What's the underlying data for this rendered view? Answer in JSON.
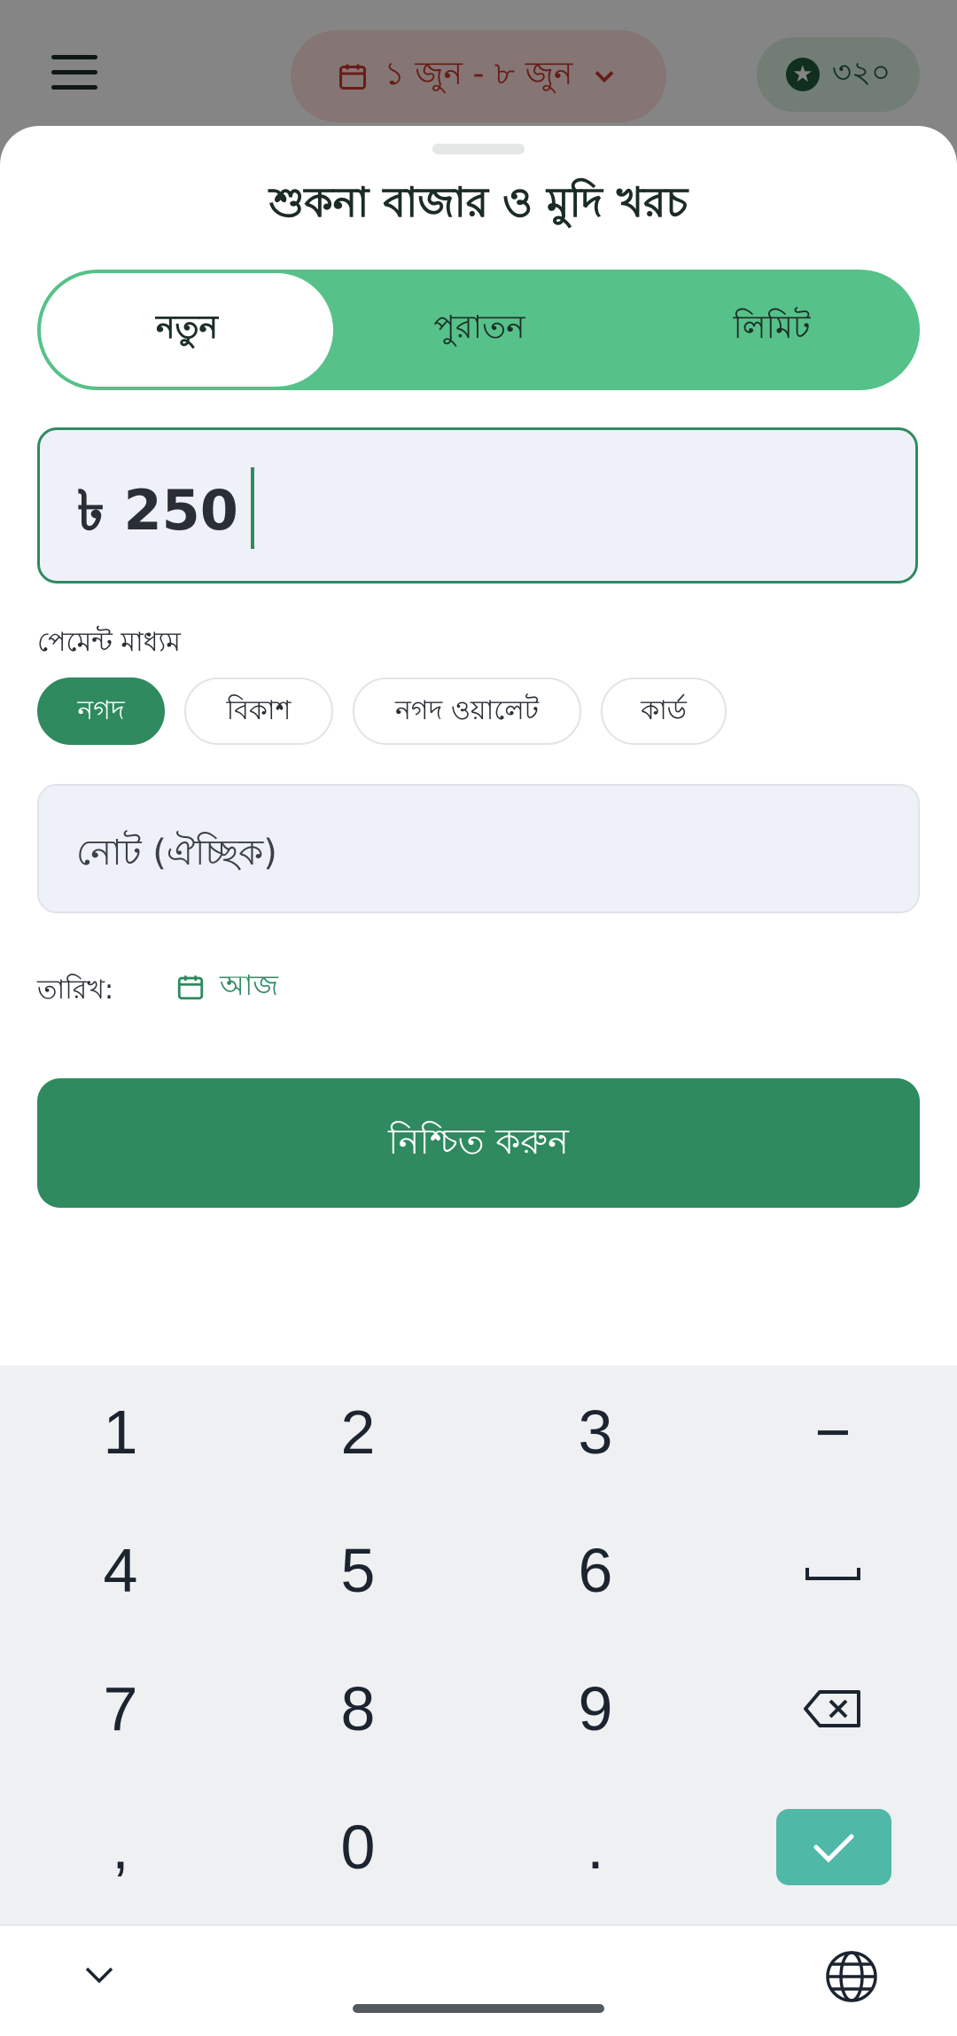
{
  "header": {
    "date_range": "১ জুন - ৮ জুন",
    "points": "৩২০"
  },
  "sheet": {
    "title": "শুকনা বাজার ও মুদি খরচ",
    "tabs": [
      {
        "label": "নতুন",
        "active": true
      },
      {
        "label": "পুরাতন",
        "active": false
      },
      {
        "label": "লিমিট",
        "active": false
      }
    ],
    "amount": {
      "value": "৳ 250"
    },
    "payment": {
      "label": "পেমেন্ট মাধ্যম",
      "options": [
        "নগদ",
        "বিকাশ",
        "নগদ ওয়ালেট",
        "কার্ড"
      ],
      "selected": "নগদ"
    },
    "note": {
      "placeholder": "নোট (ঐচ্ছিক)"
    },
    "date": {
      "label": "তারিখ:",
      "value": "আজ"
    },
    "confirm_label": "নিশ্চিত করুন"
  },
  "keyboard": {
    "rows": [
      [
        "1",
        "2",
        "3",
        "−"
      ],
      [
        "4",
        "5",
        "6",
        "space"
      ],
      [
        "7",
        "8",
        "9",
        "backspace"
      ],
      [
        ",",
        "0",
        ".",
        "enter"
      ]
    ],
    "labels": {
      "k1": "1",
      "k2": "2",
      "k3": "3",
      "kminus": "−",
      "k4": "4",
      "k5": "5",
      "k6": "6",
      "k7": "7",
      "k8": "8",
      "k9": "9",
      "kcomma": ",",
      "k0": "0",
      "kdot": "."
    },
    "enter_color": "#4fb8a7"
  },
  "colors": {
    "brand_green": "#2f8a5f",
    "tab_green": "#56c189",
    "date_chip_red": "#c8362c",
    "input_bg": "#eff1f9"
  }
}
